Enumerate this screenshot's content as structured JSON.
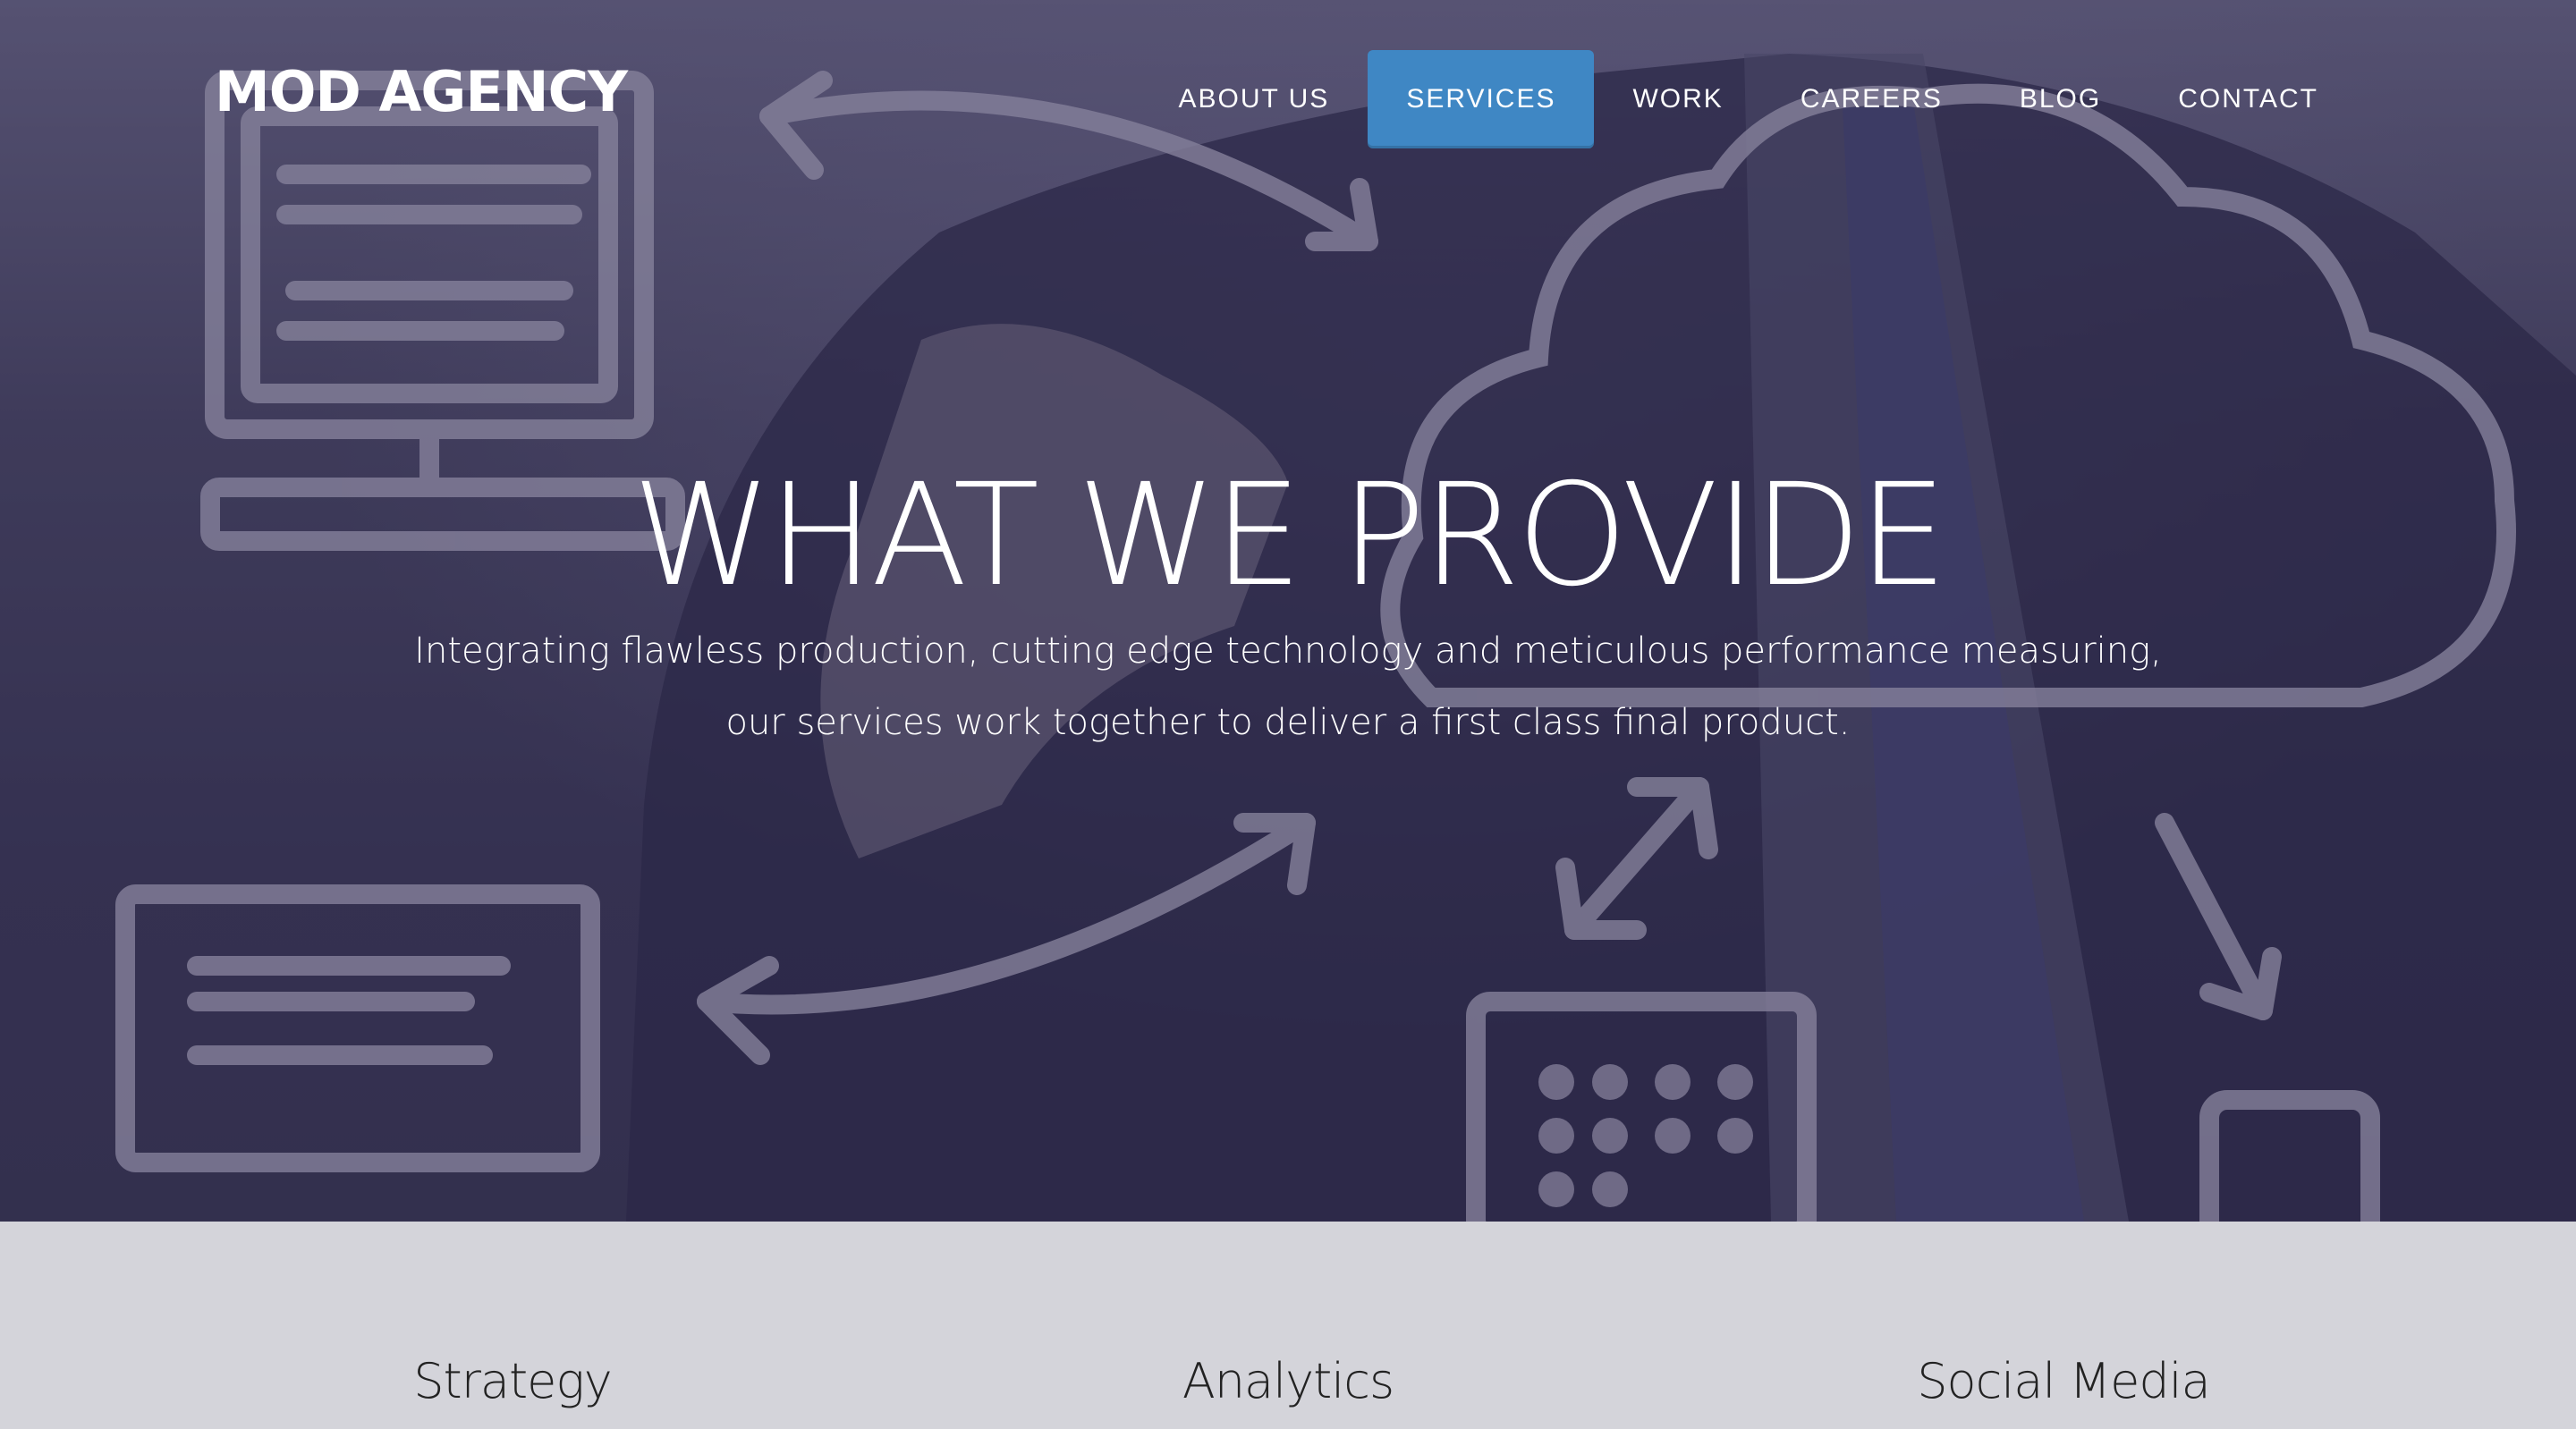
{
  "brand": {
    "logo": "MOD AGENCY"
  },
  "nav": {
    "items": [
      {
        "label": "ABOUT US",
        "active": false
      },
      {
        "label": "SERVICES",
        "active": true
      },
      {
        "label": "WORK",
        "active": false
      },
      {
        "label": "CAREERS",
        "active": false
      },
      {
        "label": "BLOG",
        "active": false
      },
      {
        "label": "CONTACT",
        "active": false
      }
    ],
    "active_color": "#3f87c4"
  },
  "hero": {
    "title": "WHAT WE PROVIDE",
    "subtitle": "Integrating flawless production, cutting edge technology and meticulous performance measuring, our services work together to deliver a first class final product.",
    "background_image": "businessman-drawing-cloud-network-sketch"
  },
  "services": {
    "items": [
      {
        "label": "Strategy"
      },
      {
        "label": "Analytics"
      },
      {
        "label": "Social Media"
      }
    ]
  }
}
